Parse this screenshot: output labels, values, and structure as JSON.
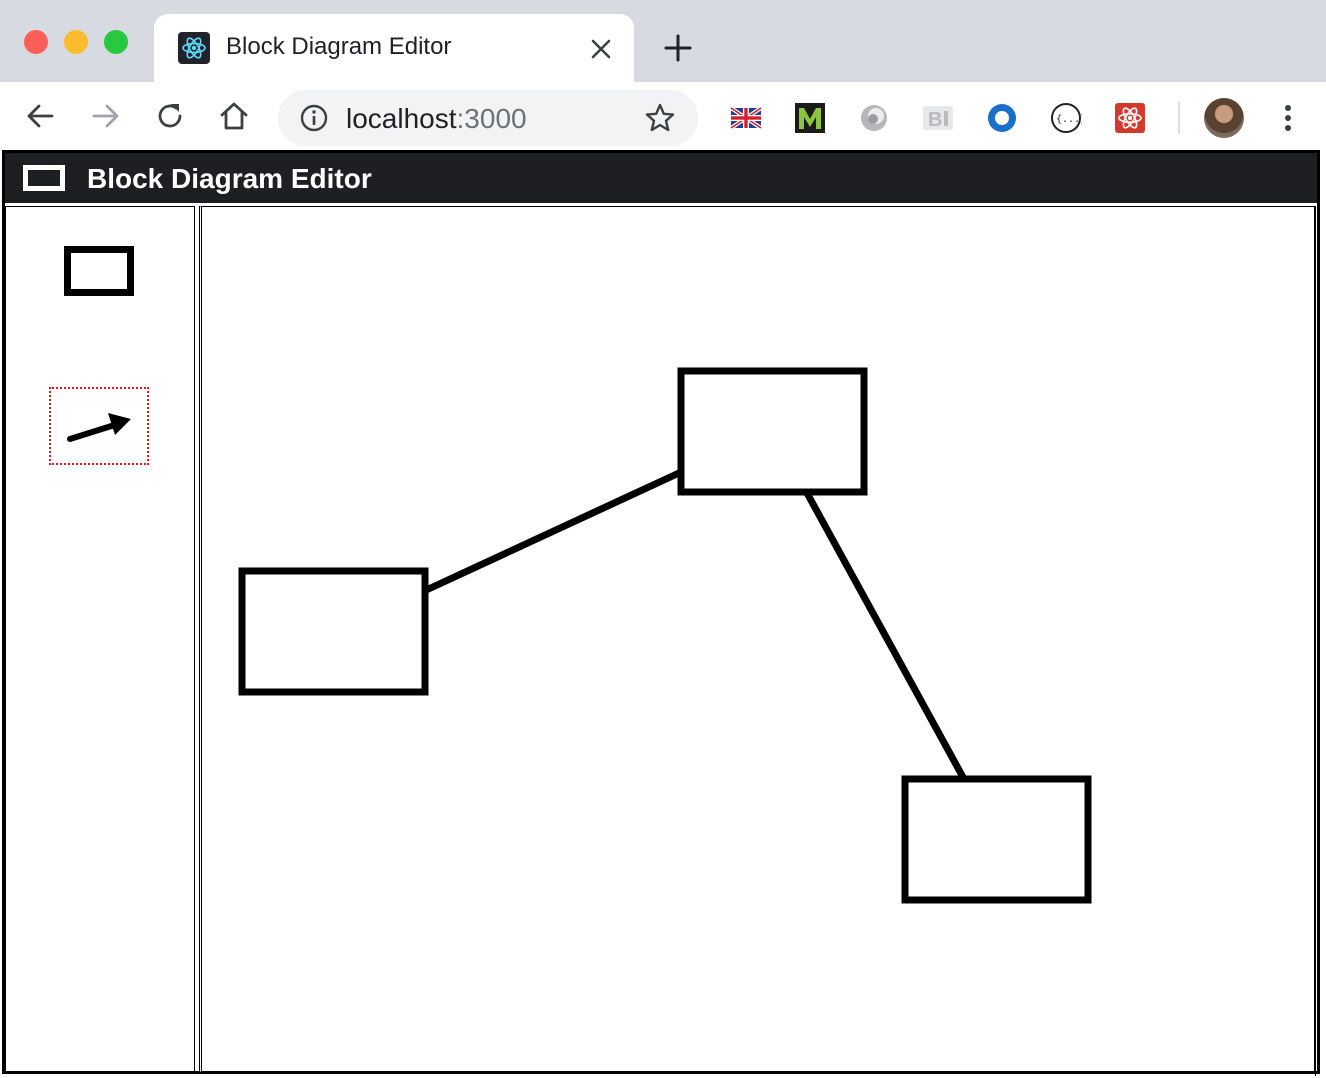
{
  "browser": {
    "tab_title": "Block Diagram Editor",
    "url_host": "localhost",
    "url_port": ":3000",
    "icons": {
      "back": "arrow-left-icon",
      "forward": "arrow-right-icon",
      "reload": "reload-icon",
      "home": "home-icon",
      "info": "info-icon",
      "bookmark": "star-icon",
      "close_tab": "close-icon",
      "new_tab": "plus-icon",
      "menu": "kebab-menu-icon"
    },
    "extensions": [
      "uk-flag-extension-icon",
      "m-extension-icon",
      "gray-circle-extension-icon",
      "bi-extension-icon",
      "blue-ring-extension-icon",
      "json-extension-icon",
      "react-devtools-extension-icon"
    ]
  },
  "app": {
    "title": "Block Diagram Editor",
    "header_color": "#1d1f23",
    "palette": {
      "tools": [
        "block-tool",
        "connector-arrow-tool"
      ],
      "selected_tool": "connector-arrow-tool",
      "selection_color": "#e0162b"
    },
    "diagram": {
      "block_count": 3,
      "connection_count": 2
    }
  }
}
